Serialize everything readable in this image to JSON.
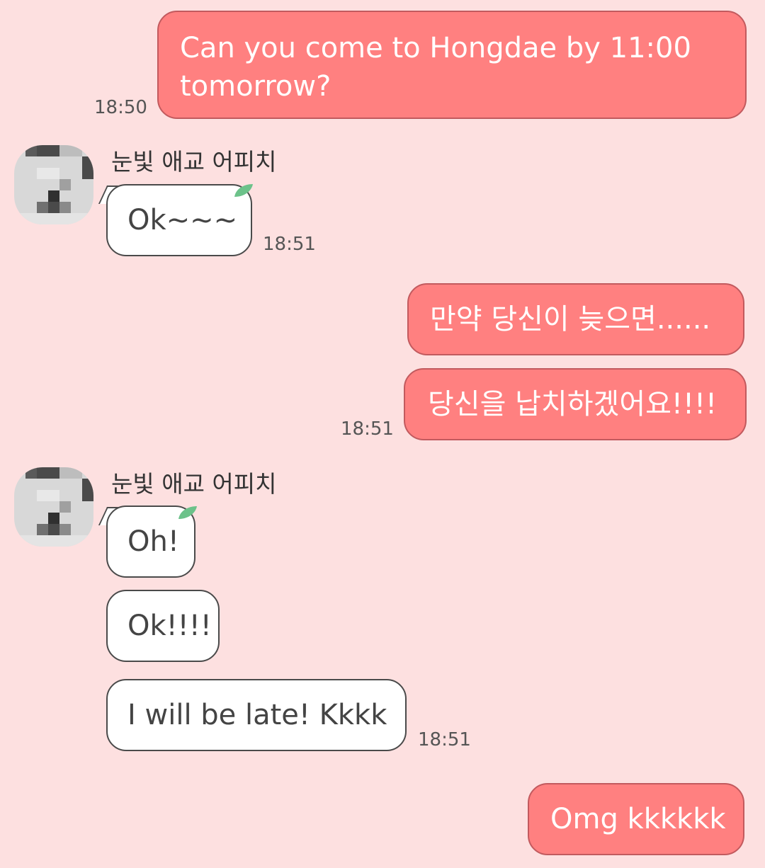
{
  "messages": {
    "m1": {
      "text_line1": "Can you come to Hongdae by 11:00",
      "text_line2": "tomorrow?",
      "time": "18:50"
    },
    "group1": {
      "sender": "눈빛 애교 어피치",
      "m1": "Ok~~~",
      "time": "18:51"
    },
    "m2": {
      "a": "만약 당신이 늦으면......",
      "b": "당신을 납치하겠어요!!!!",
      "time": "18:51"
    },
    "group2": {
      "sender": "눈빛 애교 어피치",
      "m1": "Oh!",
      "m2": "Ok!!!!",
      "m3": "I will be late!  Kkkk",
      "time": "18:51"
    },
    "m3": {
      "text": "Omg kkkkkk"
    }
  },
  "colors": {
    "background": "#fde0e0",
    "outgoing": "#ff8080",
    "incoming": "#ffffff",
    "leaf": "#6cc28a"
  }
}
